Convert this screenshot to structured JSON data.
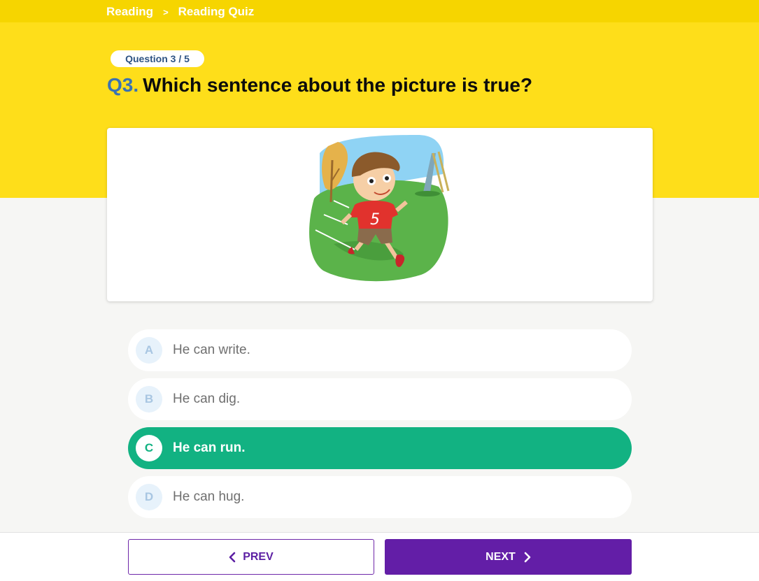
{
  "breadcrumb": {
    "items": [
      "Reading",
      "Reading Quiz"
    ],
    "separator": ">"
  },
  "question": {
    "progress": "Question 3 / 5",
    "number": "Q3.",
    "text": "Which sentence about the picture is true?",
    "image_icon": "running-boy-illustration"
  },
  "options": [
    {
      "letter": "A",
      "text": "He can write.",
      "selected": false
    },
    {
      "letter": "B",
      "text": "He can dig.",
      "selected": false
    },
    {
      "letter": "C",
      "text": "He can run.",
      "selected": true
    },
    {
      "letter": "D",
      "text": "He can hug.",
      "selected": false
    }
  ],
  "nav": {
    "prev_label": "PREV",
    "next_label": "NEXT",
    "prev_icon": "chevron-left-icon",
    "next_icon": "chevron-right-icon"
  },
  "colors": {
    "header_yellow": "#fede1a",
    "accent_purple": "#631ea7",
    "selected_green": "#12b282",
    "question_blue": "#3b73b1"
  }
}
